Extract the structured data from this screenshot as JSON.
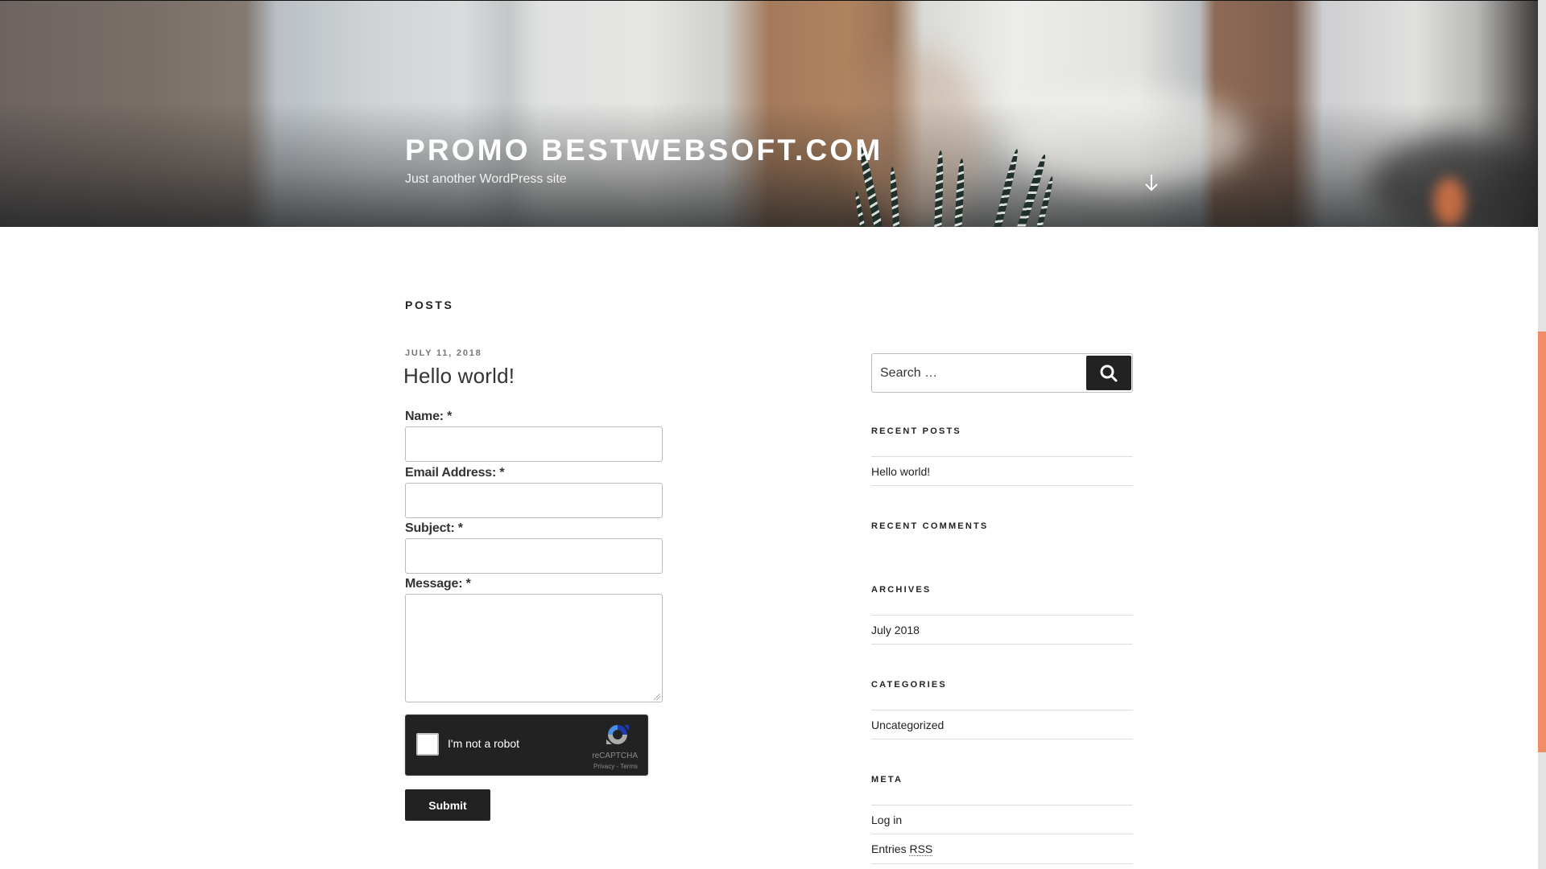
{
  "header": {
    "site_title": "PROMO BESTWEBSOFT.COM",
    "tagline": "Just another WordPress site",
    "scroll_icon": "arrow-down-icon"
  },
  "main": {
    "section_heading": "POSTS",
    "post": {
      "date": "JULY 11, 2018",
      "title": "Hello world!"
    },
    "form": {
      "fields": [
        {
          "label": "Name:",
          "required_mark": "*",
          "value": ""
        },
        {
          "label": "Email Address:",
          "required_mark": "*",
          "value": ""
        },
        {
          "label": "Subject:",
          "required_mark": "*",
          "value": ""
        },
        {
          "label": "Message:",
          "required_mark": "*",
          "value": ""
        }
      ],
      "recaptcha": {
        "label": "I'm not a robot",
        "brand": "reCAPTCHA",
        "links": "Privacy - Terms",
        "checked": false
      },
      "submit_label": "Submit"
    }
  },
  "sidebar": {
    "search": {
      "placeholder": "Search …",
      "button_icon": "search-icon"
    },
    "widgets": [
      {
        "title": "RECENT POSTS",
        "items": [
          "Hello world!"
        ]
      },
      {
        "title": "RECENT COMMENTS",
        "items": []
      },
      {
        "title": "ARCHIVES",
        "items": [
          "July 2018"
        ]
      },
      {
        "title": "CATEGORIES",
        "items": [
          "Uncategorized"
        ]
      },
      {
        "title": "META",
        "items": [
          "Log in",
          "Entries RSS"
        ]
      }
    ],
    "meta_entries_prefix": "Entries",
    "meta_entries_abbr": "RSS"
  },
  "colors": {
    "accent_scrollbar": "#f08d66",
    "button_dark": "#222222",
    "date_gray": "#767676"
  }
}
